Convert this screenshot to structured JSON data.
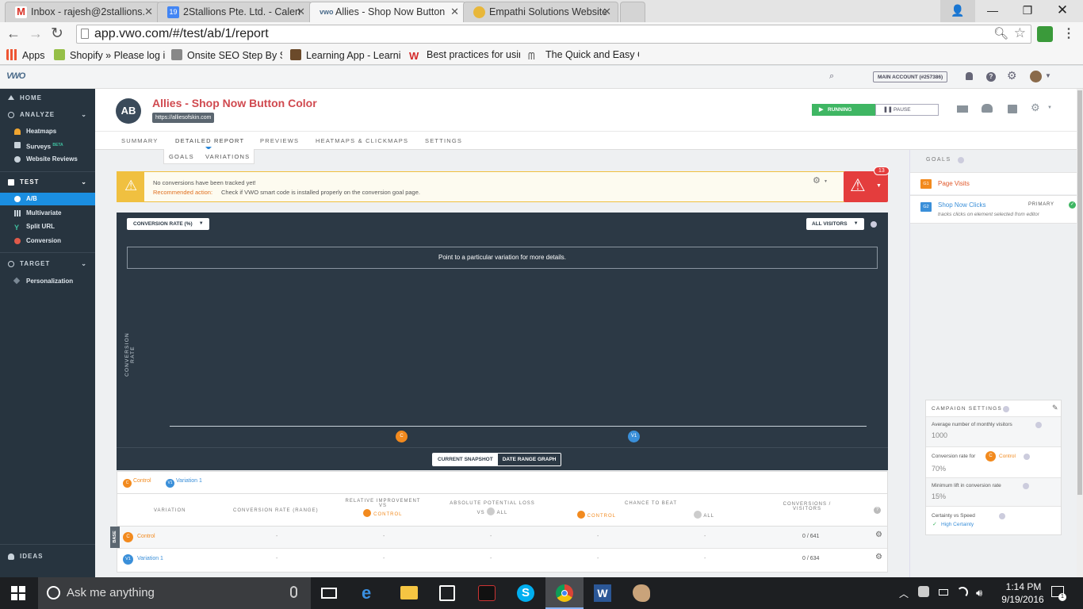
{
  "browser": {
    "tabs": [
      {
        "label": "Inbox - rajesh@2stallions.",
        "active": false
      },
      {
        "label": "2Stallions Pte. Ltd. - Calen",
        "active": false
      },
      {
        "label": "Allies - Shop Now Button",
        "active": true
      },
      {
        "label": "Empathi Solutions Website",
        "active": false
      }
    ],
    "calendar_badge": "19",
    "url": "app.vwo.com/#/test/ab/1/report",
    "bookmarks": [
      {
        "label": "Apps"
      },
      {
        "label": "Shopify » Please log in"
      },
      {
        "label": "Onsite SEO Step By St"
      },
      {
        "label": "Learning App - Learni"
      },
      {
        "label": "Best practices for usin"
      },
      {
        "label": "The Quick and Easy G"
      }
    ]
  },
  "vwo": {
    "logo": "VWO",
    "account_label": "MAIN ACCOUNT (#257386)"
  },
  "sidebar": {
    "home": "HOME",
    "analyze": "ANALYZE",
    "analyze_items": [
      "Heatmaps",
      "Surveys",
      "Website Reviews"
    ],
    "surveys_badge": "BETA",
    "test": "TEST",
    "test_items": [
      "A/B",
      "Multivariate",
      "Split URL",
      "Conversion"
    ],
    "target": "TARGET",
    "target_items": [
      "Personalization"
    ],
    "ideas": "IDEAS"
  },
  "campaign": {
    "avatar_text": "AB",
    "title": "Allies - Shop Now Button Color",
    "url": "https://alliesofskin.com",
    "status": "RUNNING",
    "pause_label": "PAUSE"
  },
  "tabs": {
    "items": [
      "SUMMARY",
      "DETAILED REPORT",
      "PREVIEWS",
      "HEATMAPS & CLICKMAPS",
      "SETTINGS"
    ],
    "subtabs": [
      "GOALS",
      "VARIATIONS"
    ]
  },
  "alert": {
    "message": "No conversions have been tracked yet!",
    "rec_label": "Recommended action:",
    "rec_text": "Check if VWO smart code is installed properly on the conversion goal page.",
    "badge_count": "13"
  },
  "chart": {
    "metric_label": "CONVERSION RATE (%)",
    "segment_label": "ALL VISITORS",
    "hint": "Point to a particular variation for more details.",
    "y_label": "CONVERSION RATE",
    "markers": [
      "C",
      "V1"
    ],
    "toggle_left": "CURRENT SNAPSHOT",
    "toggle_right": "DATE RANGE GRAPH"
  },
  "legend": [
    {
      "badge": "C",
      "label": "Control",
      "color": "#f28a1e"
    },
    {
      "badge": "V1",
      "label": "Variation 1",
      "color": "#3a8fd9"
    }
  ],
  "table": {
    "headers": {
      "variation": "VARIATION",
      "conv_rate": "CONVERSION RATE (RANGE)",
      "rel_imp_1": "RELATIVE IMPROVEMENT",
      "rel_imp_2": "VS",
      "rel_imp_3": "CONTROL",
      "abs_loss_1": "ABSOLUTE POTENTIAL LOSS",
      "abs_loss_2": "VS",
      "abs_loss_3": "ALL",
      "chance": "CHANCE TO BEAT",
      "chance_control": "CONTROL",
      "chance_all": "ALL",
      "conv_vis_1": "CONVERSIONS /",
      "conv_vis_2": "VISITORS"
    },
    "base_label": "BASE",
    "dash": "-",
    "rows": [
      {
        "badge": "C",
        "name": "Control",
        "conv": "0 / 641"
      },
      {
        "badge": "V1",
        "name": "Variation 1",
        "conv": "0 / 634"
      }
    ]
  },
  "goals": {
    "header": "GOALS",
    "items": [
      {
        "id": "G1",
        "name": "Page Visits"
      },
      {
        "id": "G2",
        "name": "Shop Now Clicks",
        "tag": "PRIMARY",
        "desc": "tracks clicks on element selected from editor"
      }
    ]
  },
  "campaign_settings": {
    "header": "CAMPAIGN SETTINGS",
    "monthly_label": "Average number of monthly visitors",
    "monthly_value": "1000",
    "conv_label": "Conversion rate for",
    "conv_control": "Control",
    "conv_value": "70%",
    "lift_label": "Minimum lift in conversion rate",
    "lift_value": "15%",
    "cert_label": "Certainty vs Speed",
    "cert_value": "High Certainty"
  },
  "taskbar": {
    "search": "Ask me anything",
    "time": "1:14 PM",
    "date": "9/19/2016",
    "notif": "1"
  }
}
